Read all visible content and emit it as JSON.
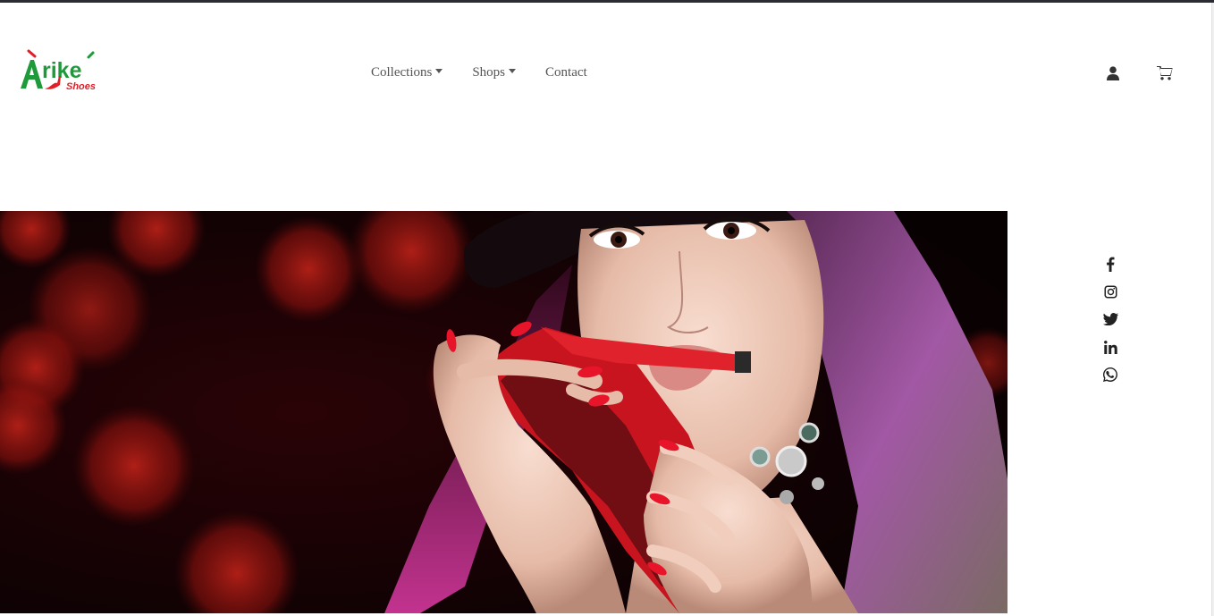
{
  "brand": {
    "name": "Àrìké",
    "tagline": "Shoes",
    "colors": {
      "primary_green": "#1f9a3a",
      "accent_red": "#e21e26"
    }
  },
  "nav": {
    "items": [
      {
        "label": "Collections",
        "has_dropdown": true
      },
      {
        "label": "Shops",
        "has_dropdown": true
      },
      {
        "label": "Contact",
        "has_dropdown": false
      }
    ],
    "icons": [
      "user-icon",
      "cart-icon"
    ]
  },
  "hero": {
    "alt": "Woman biting a red lace high-heel shoe"
  },
  "social": [
    "facebook-icon",
    "instagram-icon",
    "twitter-icon",
    "linkedin-icon",
    "whatsapp-icon"
  ]
}
